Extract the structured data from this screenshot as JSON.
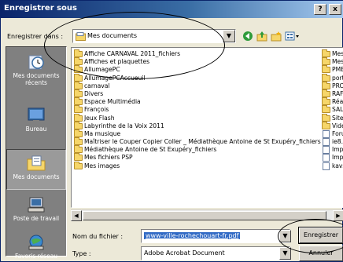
{
  "window": {
    "title": "Enregistrer sous",
    "help_label": "?",
    "close_label": "x"
  },
  "toolbar": {
    "save_in_label": "Enregistrer dans :",
    "save_in_value": "Mes documents",
    "combo_arrow": "▼"
  },
  "places": [
    {
      "label": "Mes documents récents",
      "icon": "recent-documents-icon"
    },
    {
      "label": "Bureau",
      "icon": "desktop-icon"
    },
    {
      "label": "Mes documents",
      "icon": "my-documents-icon"
    },
    {
      "label": "Poste de travail",
      "icon": "my-computer-icon"
    },
    {
      "label": "Favoris réseau",
      "icon": "network-places-icon"
    }
  ],
  "files_col1": [
    {
      "name": "Affiche CARNAVAL  2011_fichiers",
      "type": "folder"
    },
    {
      "name": "Affiches et plaquettes",
      "type": "folder"
    },
    {
      "name": "AllumagePC",
      "type": "folder"
    },
    {
      "name": "AllumagePCAccueuil",
      "type": "folder"
    },
    {
      "name": "carnaval",
      "type": "folder"
    },
    {
      "name": "Divers",
      "type": "folder"
    },
    {
      "name": "Espace Multimédia",
      "type": "folder"
    },
    {
      "name": "François",
      "type": "folder"
    },
    {
      "name": "Jeux Flash",
      "type": "folder"
    },
    {
      "name": "Labyrinthe de la Voix 2011",
      "type": "folder"
    },
    {
      "name": "Ma musique",
      "type": "folder"
    },
    {
      "name": "Maîtriser le Couper Copier Coller _ Médiathèque Antoine de St Exupéry_fichiers",
      "type": "folder"
    },
    {
      "name": "Médiathèque Antoine de St Exupéry_fichiers",
      "type": "folder"
    },
    {
      "name": "Mes fichiers PSP",
      "type": "folder"
    },
    {
      "name": "Mes images",
      "type": "folder"
    }
  ],
  "files_col2": [
    {
      "name": "Mes",
      "type": "folder"
    },
    {
      "name": "Mes",
      "type": "folder"
    },
    {
      "name": "PME",
      "type": "folder"
    },
    {
      "name": "port",
      "type": "folder"
    },
    {
      "name": "PRC",
      "type": "folder"
    },
    {
      "name": "RAF",
      "type": "folder"
    },
    {
      "name": "Réa",
      "type": "folder"
    },
    {
      "name": "SAL",
      "type": "folder"
    },
    {
      "name": "Site",
      "type": "folder"
    },
    {
      "name": "Vidé",
      "type": "folder"
    },
    {
      "name": "Foru",
      "type": "doc"
    },
    {
      "name": "ie8.",
      "type": "doc"
    },
    {
      "name": "Imp",
      "type": "doc"
    },
    {
      "name": "Imp",
      "type": "doc"
    },
    {
      "name": "kav:",
      "type": "doc"
    }
  ],
  "form": {
    "filename_label": "Nom du fichier :",
    "filename_value": "www-ville-rochechouart-fr.pdf",
    "type_label": "Type :",
    "type_value": "Adobe Acrobat Document",
    "save_button": "Enregistrer",
    "cancel_button": "Annuler"
  }
}
